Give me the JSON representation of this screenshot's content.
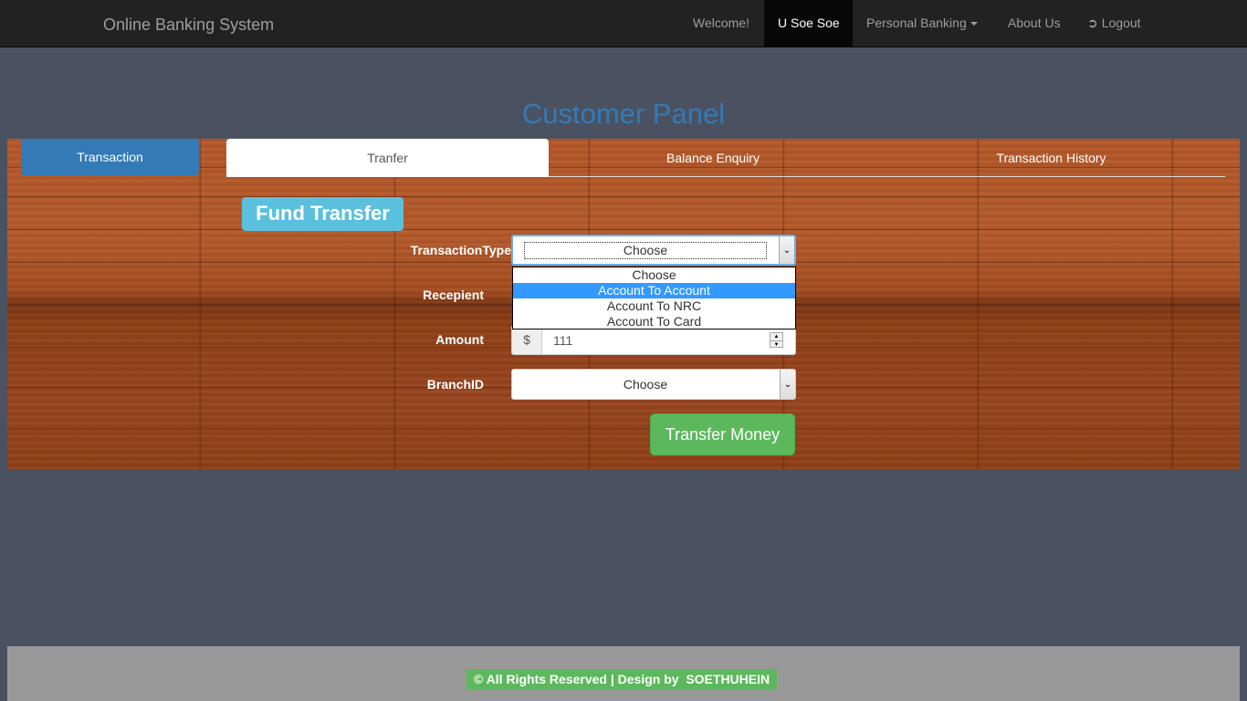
{
  "navbar": {
    "brand": "Online Banking System",
    "items": [
      {
        "label": "Welcome!"
      },
      {
        "label": "U Soe Soe"
      },
      {
        "label": "Personal Banking"
      },
      {
        "label": "About Us"
      },
      {
        "label": "Logout",
        "icon": "logout-icon"
      }
    ]
  },
  "page_title": "Customer Panel",
  "side_tab": "Transaction",
  "tabs": [
    {
      "label": "Tranfer",
      "active": true
    },
    {
      "label": "Balance Enquiry"
    },
    {
      "label": "Transaction History"
    }
  ],
  "form": {
    "heading": "Fund Transfer",
    "transaction_type": {
      "label": "TransactionType",
      "value": "Choose"
    },
    "dropdown_options": [
      "Choose",
      "Account To Account",
      "Account To NRC",
      "Account To Card"
    ],
    "highlighted_option": "Account To Account",
    "recipient": {
      "label": "Recepient"
    },
    "amount": {
      "label": "Amount",
      "addon": "$",
      "value": "111"
    },
    "branch": {
      "label": "BranchID",
      "value": "Choose"
    },
    "submit_label": "Transfer Money"
  },
  "footer": {
    "text": "© All Rights Reserved | Design by  SOETHUHEIN"
  },
  "colors": {
    "navbar": "#222222",
    "primary": "#337ab7",
    "info": "#5bc0de",
    "success": "#5cb85c",
    "background": "#4a5262"
  }
}
